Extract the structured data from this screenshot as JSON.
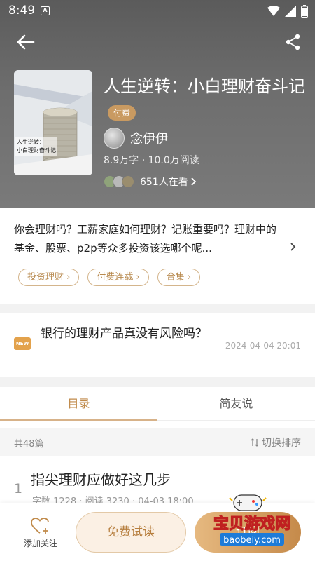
{
  "status": {
    "time": "8:49",
    "a_label": "A"
  },
  "book": {
    "title": "人生逆转：小白理财奋斗记",
    "paid_badge": "付费",
    "author": "念伊伊",
    "stats": "8.9万字 · 10.0万阅读",
    "readers": "651人在看",
    "cover_text_line1": "人生逆转：",
    "cover_text_line2": "小白理财奋斗记"
  },
  "description": "你会理财吗？工薪家庭如何理财？记账重要吗？理财中的基金、股票、p2p等众多投资该选哪个呢...",
  "tags": [
    "投资理财",
    "付费连载",
    "合集"
  ],
  "news": {
    "badge": "NEW",
    "title": "银行的理财产品真没有风险吗？",
    "date": "2024-04-04 20:01"
  },
  "tabs": [
    {
      "label": "目录"
    },
    {
      "label": "简友说"
    }
  ],
  "list": {
    "count": "共48篇",
    "sort_label": "切换排序"
  },
  "chapters": [
    {
      "index": "1",
      "title": "指尖理财应做好这几步",
      "meta": "字数 1228 · 阅读 3230 · 04-03 18:00"
    }
  ],
  "bottom": {
    "follow_label": "添加关注",
    "trial_label": "免费试读",
    "buy_label": "订阅"
  },
  "watermark": {
    "line1": "宝贝游戏网",
    "line2": "baobeiy.com"
  },
  "colors": {
    "accent": "#c08a4a",
    "tag": "#b88a4f",
    "news_badge": "#e3a24c"
  }
}
